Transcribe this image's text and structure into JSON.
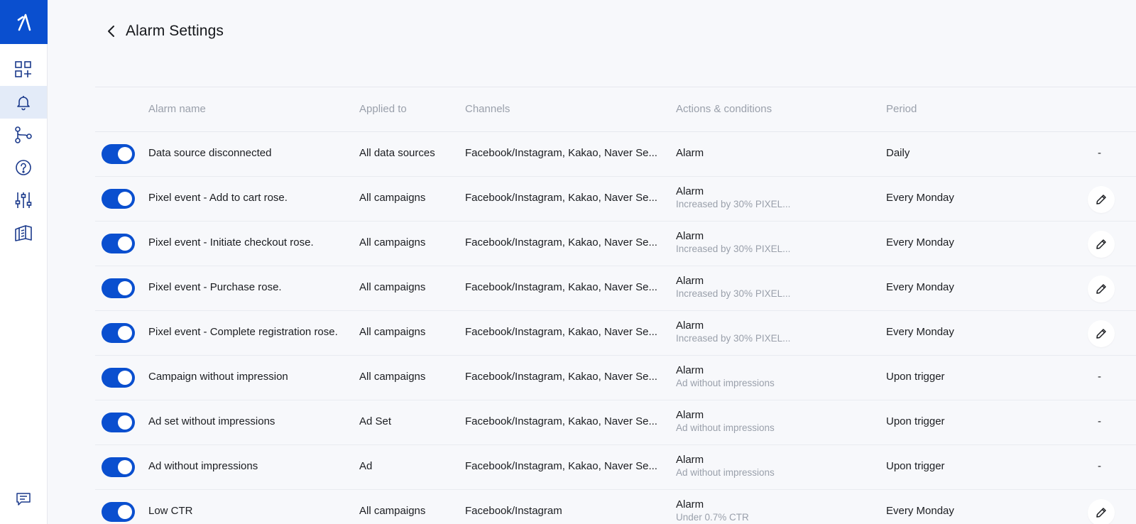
{
  "app": {
    "accent": "#0a4fcf",
    "logo_icon": "brand-logo-icon"
  },
  "sidebar": {
    "items": [
      {
        "icon": "dashboard-add-icon",
        "active": false
      },
      {
        "icon": "bell-icon",
        "active": true
      },
      {
        "icon": "flow-icon",
        "active": false
      },
      {
        "icon": "help-icon",
        "active": false
      },
      {
        "icon": "sliders-icon",
        "active": false
      },
      {
        "icon": "docs-icon",
        "active": false
      }
    ],
    "feedback_icon": "chat-icon"
  },
  "header": {
    "back_icon": "chevron-left-icon",
    "title": "Alarm Settings"
  },
  "table": {
    "columns": [
      "Alarm name",
      "Applied to",
      "Channels",
      "Actions & conditions",
      "Period"
    ],
    "rows": [
      {
        "enabled": true,
        "name": "Data source disconnected",
        "applied_to": "All data sources",
        "channels": "Facebook/Instagram, Kakao, Naver Se...",
        "action": "Alarm",
        "condition": "",
        "period": "Daily",
        "edit": false,
        "dash": "-"
      },
      {
        "enabled": true,
        "name": "Pixel event - Add to cart rose.",
        "applied_to": "All campaigns",
        "channels": "Facebook/Instagram, Kakao, Naver Se...",
        "action": "Alarm",
        "condition": "Increased by 30% PIXEL...",
        "period": "Every Monday",
        "edit": true,
        "dash": ""
      },
      {
        "enabled": true,
        "name": "Pixel event - Initiate checkout rose.",
        "applied_to": "All campaigns",
        "channels": "Facebook/Instagram, Kakao, Naver Se...",
        "action": "Alarm",
        "condition": "Increased by 30% PIXEL...",
        "period": "Every Monday",
        "edit": true,
        "dash": ""
      },
      {
        "enabled": true,
        "name": "Pixel event - Purchase rose.",
        "applied_to": "All campaigns",
        "channels": "Facebook/Instagram, Kakao, Naver Se...",
        "action": "Alarm",
        "condition": "Increased by 30% PIXEL...",
        "period": "Every Monday",
        "edit": true,
        "dash": ""
      },
      {
        "enabled": true,
        "name": "Pixel event - Complete registration rose.",
        "applied_to": "All campaigns",
        "channels": "Facebook/Instagram, Kakao, Naver Se...",
        "action": "Alarm",
        "condition": "Increased by 30% PIXEL...",
        "period": "Every Monday",
        "edit": true,
        "dash": ""
      },
      {
        "enabled": true,
        "name": "Campaign without impression",
        "applied_to": "All campaigns",
        "channels": "Facebook/Instagram, Kakao, Naver Se...",
        "action": "Alarm",
        "condition": "Ad without impressions",
        "period": "Upon trigger",
        "edit": false,
        "dash": "-"
      },
      {
        "enabled": true,
        "name": "Ad set without impressions",
        "applied_to": "Ad Set",
        "channels": "Facebook/Instagram, Kakao, Naver Se...",
        "action": "Alarm",
        "condition": "Ad without impressions",
        "period": "Upon trigger",
        "edit": false,
        "dash": "-"
      },
      {
        "enabled": true,
        "name": "Ad without impressions",
        "applied_to": "Ad",
        "channels": "Facebook/Instagram, Kakao, Naver Se...",
        "action": "Alarm",
        "condition": "Ad without impressions",
        "period": "Upon trigger",
        "edit": false,
        "dash": "-"
      },
      {
        "enabled": true,
        "name": "Low CTR",
        "applied_to": "All campaigns",
        "channels": "Facebook/Instagram",
        "action": "Alarm",
        "condition": "Under 0.7% CTR",
        "period": "Every Monday",
        "edit": true,
        "dash": ""
      }
    ]
  }
}
